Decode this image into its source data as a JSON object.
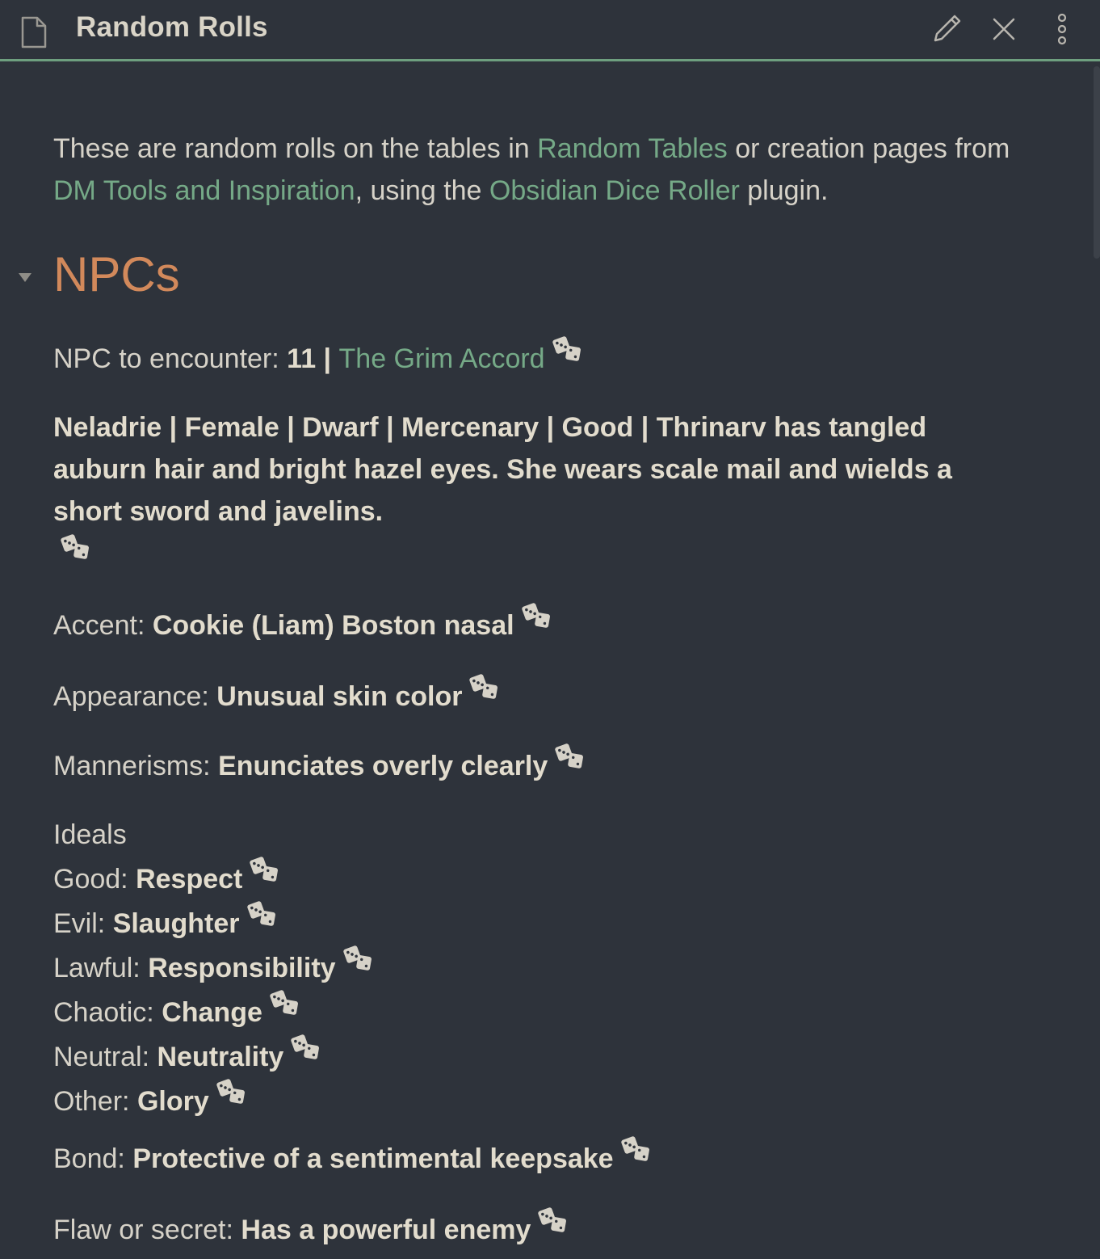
{
  "header": {
    "title": "Random Rolls",
    "icons": [
      "file-icon",
      "pencil-icon",
      "close-icon",
      "more-vertical-icon"
    ]
  },
  "intro": {
    "t1": "These are random rolls on the tables in ",
    "link1": "Random Tables",
    "t2": " or creation pages from ",
    "link2": "DM Tools and Inspiration",
    "t3": ", using the ",
    "link3": "Obsidian Dice Roller",
    "t4": " plugin."
  },
  "section": {
    "heading": "NPCs"
  },
  "npc": {
    "encounter_label": "NPC to encounter: ",
    "encounter_num": "11",
    "encounter_sep": " | ",
    "encounter_link": "The Grim Accord",
    "description_line1": "Neladrie | Female | Dwarf | Mercenary | Good | Thrinarv has tangled",
    "description_line2": "auburn hair and bright hazel eyes. She wears scale mail and wields a",
    "description_line3": "short sword and javelins.",
    "accent_label": "Accent: ",
    "accent_value": "Cookie (Liam) Boston nasal",
    "appearance_label": "Appearance: ",
    "appearance_value": "Unusual skin color",
    "mannerisms_label": "Mannerisms: ",
    "mannerisms_value": "Enunciates overly clearly",
    "ideals_heading": "Ideals",
    "ideals": [
      {
        "label": "Good: ",
        "value": "Respect"
      },
      {
        "label": "Evil: ",
        "value": "Slaughter"
      },
      {
        "label": "Lawful: ",
        "value": "Responsibility"
      },
      {
        "label": "Chaotic: ",
        "value": "Change"
      },
      {
        "label": "Neutral: ",
        "value": "Neutrality"
      },
      {
        "label": "Other: ",
        "value": "Glory"
      }
    ],
    "bond_label": "Bond: ",
    "bond_value": "Protective of a sentimental keepsake",
    "flaw_label": "Flaw or secret: ",
    "flaw_value": "Has a powerful enemy"
  },
  "colors": {
    "background": "#2e333b",
    "text": "#d6d2c8",
    "link": "#75a987",
    "heading": "#d2895b",
    "accent_border": "#6e9f7f"
  }
}
